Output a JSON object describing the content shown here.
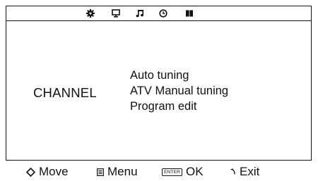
{
  "tabs": [
    {
      "icon": "gear-icon",
      "name": "setup"
    },
    {
      "icon": "monitor-icon",
      "name": "picture"
    },
    {
      "icon": "music-note-icon",
      "name": "sound"
    },
    {
      "icon": "clock-icon",
      "name": "time"
    },
    {
      "icon": "book-icon",
      "name": "channel"
    }
  ],
  "category": "CHANNEL",
  "menu": {
    "items": [
      "Auto tuning",
      "ATV Manual tuning",
      "Program edit"
    ]
  },
  "footer": {
    "move_label": "Move",
    "menu_label": "Menu",
    "enter_key": "ENTER",
    "ok_label": "OK",
    "exit_label": "Exit"
  },
  "colors": {
    "foreground": "#111111",
    "background": "#ffffff"
  }
}
